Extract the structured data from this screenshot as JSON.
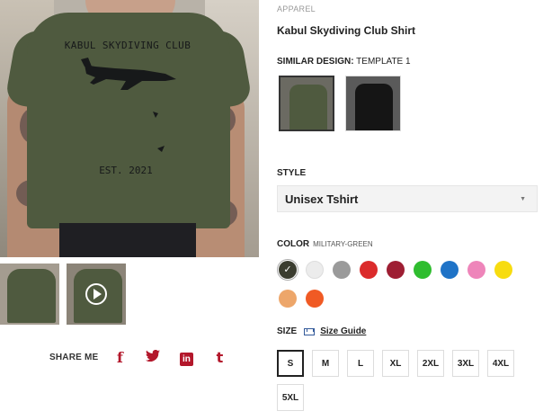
{
  "product": {
    "category": "APPAREL",
    "title": "Kabul Skydiving Club Shirt",
    "shirt_print": {
      "line1": "KABUL SKYDIVING CLUB",
      "line2": "EST. 2021"
    }
  },
  "share": {
    "label": "SHARE ME",
    "icons": [
      "facebook-icon",
      "twitter-icon",
      "linkedin-icon",
      "tumblr-icon"
    ],
    "facebook_glyph": "f",
    "twitter_glyph": "🐦",
    "linkedin_glyph": "in",
    "tumblr_glyph": "t",
    "color": "#b3172b"
  },
  "similar_design": {
    "label": "SIMILAR DESIGN:",
    "value": "TEMPLATE 1",
    "options": [
      "military-green",
      "black"
    ]
  },
  "style": {
    "label": "STYLE",
    "value": "Unisex Tshirt",
    "caret": "▼"
  },
  "color": {
    "label": "COLOR",
    "selected": "MILITARY-GREEN",
    "check": "✓",
    "swatches": [
      "#3b3d30",
      "#ececec",
      "#9a9a9a",
      "#db2b2b",
      "#9e1e33",
      "#2fbd2f",
      "#1f73c7",
      "#ee85ba",
      "#f7dc10",
      "#eda66a",
      "#f05a24"
    ]
  },
  "size": {
    "label": "SIZE",
    "guide": "Size Guide",
    "options": [
      "S",
      "M",
      "L",
      "XL",
      "2XL",
      "3XL",
      "4XL",
      "5XL"
    ],
    "selected": "S"
  }
}
